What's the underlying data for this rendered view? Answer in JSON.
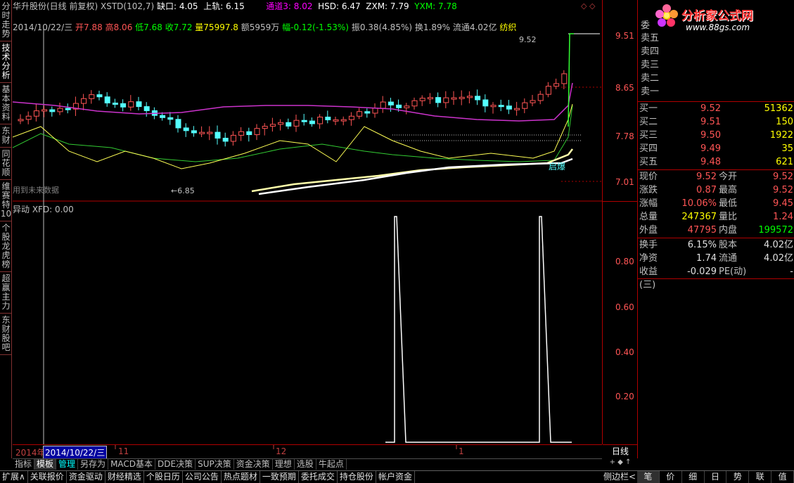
{
  "header": {
    "stock": "华升股份(日线 前复权)",
    "ind1": "XSTD(102,7)",
    "gap": "缺口: 4.05",
    "upper": "上轨: 6.15",
    "tong": "通道3: 8.02",
    "hsd": "HSD: 6.47",
    "zxm": "ZXM: 7.79",
    "yxm": "YXM: 7.78"
  },
  "info": {
    "date": "2014/10/22/三",
    "open": "开7.88",
    "high": "高8.06",
    "low": "低7.68",
    "close": "收7.72",
    "vol": "量75997.8",
    "amt": "额5959万",
    "chg": "幅-0.12(-1.53%)",
    "amp": "振0.38(4.85%)",
    "turn": "换1.89%",
    "float": "流通4.02亿",
    "ind": "纺织"
  },
  "chart_labels": {
    "hi_label": "9.52",
    "lo_label": "6.85",
    "future": "用到未来数据",
    "qibao": "启爆",
    "sub_title": "异动 XFD: 0.00"
  },
  "price_axis": [
    "9.51",
    "8.65",
    "7.78",
    "7.01"
  ],
  "sub_axis": [
    "0.80",
    "0.60",
    "0.40",
    "0.20"
  ],
  "xaxis": {
    "year": "2014年",
    "cursor": "2014/10/22/三",
    "m11": "11",
    "m12": "12",
    "m1": "1",
    "period": "日线"
  },
  "left_tabs": [
    "分时走势",
    "技术分析",
    "基本资料",
    "东财",
    "同花顺",
    "维赛特10",
    "个股龙虎榜",
    "超赢主力",
    "东财股吧"
  ],
  "bottom_tabs1": [
    "指标",
    "模板",
    "管理",
    "另存为",
    "MACD基本",
    "DDE决策",
    "SUP决策",
    "资金决策",
    "理想",
    "选股",
    "牛起点"
  ],
  "bottom_tabs2": [
    "扩展∧",
    "关联报价",
    "资金驱动",
    "财经精选",
    "个股日历",
    "公司公告",
    "热点题材",
    "一致预期",
    "委托成交",
    "持仓股份",
    "帐户资金"
  ],
  "bottom_right": [
    "笔",
    "价",
    "细",
    "日",
    "势",
    "联",
    "值"
  ],
  "side_label": "侧边栏<",
  "logo": {
    "title": "分析家公式网",
    "url": "www.88gs.com"
  },
  "quote": {
    "wei": "委",
    "sell": [
      {
        "k": "卖五"
      },
      {
        "k": "卖四"
      },
      {
        "k": "卖三"
      },
      {
        "k": "卖二"
      },
      {
        "k": "卖一"
      }
    ],
    "buy": [
      {
        "k": "买一",
        "p": "9.52",
        "v": "51362"
      },
      {
        "k": "买二",
        "p": "9.51",
        "v": "150"
      },
      {
        "k": "买三",
        "p": "9.50",
        "v": "1922"
      },
      {
        "k": "买四",
        "p": "9.49",
        "v": "35"
      },
      {
        "k": "买五",
        "p": "9.48",
        "v": "621"
      }
    ],
    "stats": [
      {
        "k1": "现价",
        "v1": "9.52",
        "k2": "今开",
        "v2": "9.52"
      },
      {
        "k1": "涨跌",
        "v1": "0.87",
        "k2": "最高",
        "v2": "9.52"
      },
      {
        "k1": "涨幅",
        "v1": "10.06%",
        "k2": "最低",
        "v2": "9.45"
      },
      {
        "k1": "总量",
        "v1": "247367",
        "k2": "量比",
        "v2": "1.24"
      },
      {
        "k1": "外盘",
        "v1": "47795",
        "k2": "内盘",
        "v2": "199572"
      }
    ],
    "stats2": [
      {
        "k1": "换手",
        "v1": "6.15%",
        "k2": "股本",
        "v2": "4.02亿"
      },
      {
        "k1": "净资",
        "v1": "1.74",
        "k2": "流通",
        "v2": "4.02亿"
      },
      {
        "k1": "收益(三)",
        "v1": "-0.029",
        "k2": "PE(动)",
        "v2": "-"
      }
    ]
  },
  "colors": {
    "up": "#ff5555",
    "down": "#54ffff",
    "border": "#b00000"
  }
}
